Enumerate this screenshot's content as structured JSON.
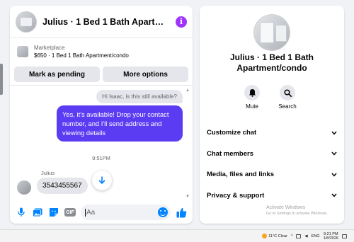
{
  "conversation": {
    "title": "Julius · 1 Bed 1 Bath Apartment/condo",
    "info_icon": "info-icon",
    "accent_color": "#a033ff"
  },
  "listing": {
    "label": "Marketplace",
    "price_title": "$650 · 1 Bed 1 Bath Apartment/condo"
  },
  "actions": {
    "mark_pending": "Mark as pending",
    "more_options": "More options"
  },
  "messages": {
    "quoted": "Hi Isaac, is this still available?",
    "sent": "Yes, it's available! Drop your contact number, and I'll send address and viewing details",
    "sent_color": "#5b3cf2",
    "timestamp": "9:51PM",
    "sender_name": "Julius",
    "received": "3543455567"
  },
  "composer": {
    "placeholder": "Aa",
    "icons": [
      "microphone-icon",
      "image-icon",
      "sticker-icon",
      "gif-icon",
      "emoji-icon",
      "thumbs-up-icon"
    ],
    "gif_label": "GIF"
  },
  "info_panel": {
    "title": "Julius · 1 Bed 1 Bath Apartment/condo",
    "mute_label": "Mute",
    "search_label": "Search",
    "menu": [
      {
        "label": "Customize chat"
      },
      {
        "label": "Chat members"
      },
      {
        "label": "Media, files and links"
      },
      {
        "label": "Privacy & support"
      }
    ],
    "activate_title": "Activate Windows",
    "activate_sub": "Go to Settings to activate Windows."
  },
  "taskbar": {
    "weather": "11°C  Clear",
    "language": "ENG",
    "time": "9:21 PM",
    "date": "1/8/2026"
  }
}
